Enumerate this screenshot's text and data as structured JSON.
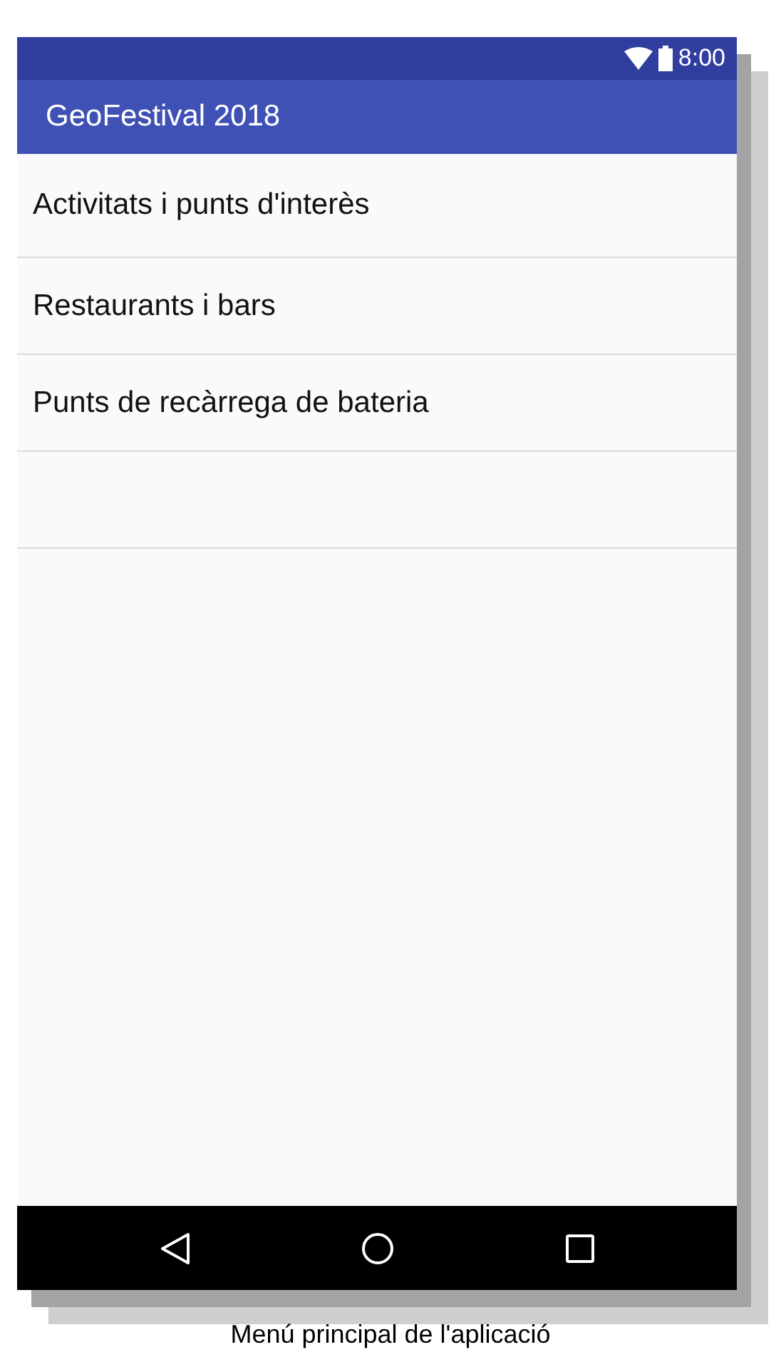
{
  "status_bar": {
    "time": "8:00"
  },
  "toolbar": {
    "title": "GeoFestival 2018"
  },
  "menu": {
    "items": [
      {
        "label": "Activitats i punts d'interès"
      },
      {
        "label": "Restaurants i bars"
      },
      {
        "label": "Punts de recàrrega de bateria"
      }
    ]
  },
  "caption": "Menú principal de l'aplicació"
}
